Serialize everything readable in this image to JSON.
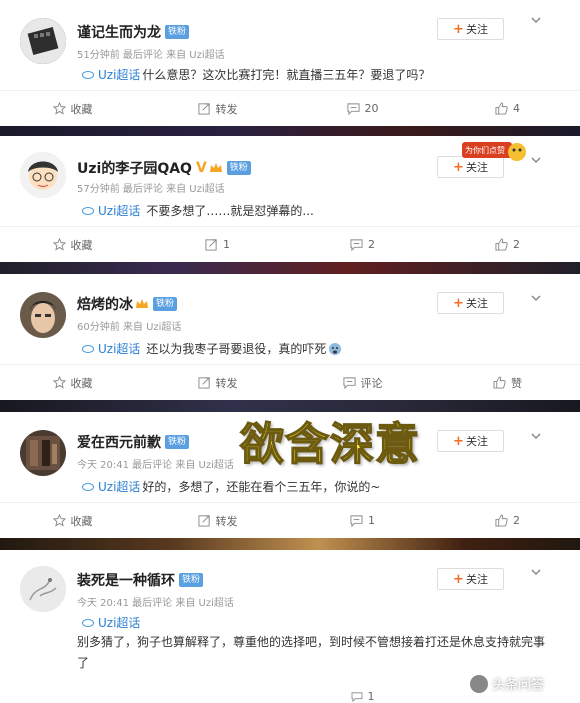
{
  "overlay_title": "欲含深意",
  "watermark": "头条问答",
  "live_badge_text": "为你们点赞",
  "posts": [
    {
      "username": "谨记生而为龙",
      "badge": "铁粉",
      "meta": "51分钟前 最后评论 来自 Uzi超话",
      "topic": "Uzi超话",
      "text": "什么意思？这次比赛打完！就直播三五年？要退了吗？",
      "follow": "关注",
      "actions": {
        "collect": "收藏",
        "forward": "转发",
        "comment": "20",
        "like": "4"
      }
    },
    {
      "username": "Uzi的李子园QAQ",
      "vmark": "V",
      "badge": "铁粉",
      "meta": "57分钟前 最后评论 来自 Uzi超话",
      "topic": "Uzi超话",
      "text": "不要多想了……就是怼弹幕的...",
      "follow": "关注",
      "actions": {
        "collect": "收藏",
        "forward": "1",
        "comment": "2",
        "like": "2"
      }
    },
    {
      "username": "焙烤的冰",
      "badge": "铁粉",
      "meta": "60分钟前 来自 Uzi超话",
      "topic": "Uzi超话",
      "text": "还以为我枣子哥要退役，真的吓死",
      "follow": "关注",
      "actions": {
        "collect": "收藏",
        "forward": "转发",
        "comment": "评论",
        "like": "赞"
      }
    },
    {
      "username": "爱在西元前歉",
      "badge": "铁粉",
      "meta": "今天 20:41 最后评论 来自 Uzi超话",
      "topic": "Uzi超话",
      "text": "好的，多想了，还能在看个三五年，你说的~",
      "follow": "关注",
      "actions": {
        "collect": "收藏",
        "forward": "转发",
        "comment": "1",
        "like": "2"
      }
    },
    {
      "username": "装死是一种循环",
      "badge": "铁粉",
      "meta": "今天 20:41 最后评论 来自 Uzi超话",
      "topic": "Uzi超话",
      "text": "别多猜了，狗子也算解释了，尊重他的选择吧，到时候不管想接着打还是休息支持就完事了",
      "follow": "关注",
      "actions": {
        "collect": "",
        "forward": "",
        "comment": "1",
        "like": ""
      }
    }
  ]
}
